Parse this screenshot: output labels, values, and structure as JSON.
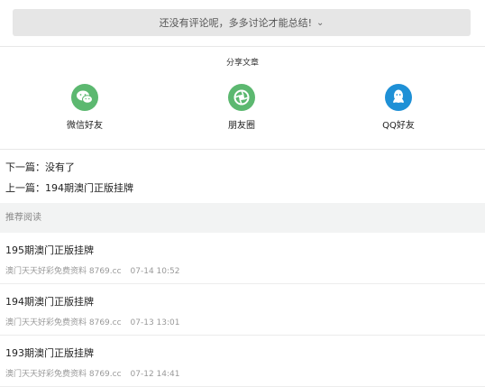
{
  "comment": {
    "text": "还没有评论呢，多多讨论才能总结!",
    "chevron": "⌄"
  },
  "share": {
    "title": "分享文章",
    "items": [
      {
        "label": "微信好友",
        "icon": "wechat-icon",
        "color": "#5cb870"
      },
      {
        "label": "朋友圈",
        "icon": "moments-icon",
        "color": "#5cb870"
      },
      {
        "label": "QQ好友",
        "icon": "qq-icon",
        "color": "#1e90d6"
      }
    ]
  },
  "nav": {
    "next_prefix": "下一篇：",
    "next_title": "没有了",
    "prev_prefix": "上一篇：",
    "prev_title": "194期澳门正版挂牌"
  },
  "recommend": {
    "header": "推荐阅读",
    "items": [
      {
        "title": "195期澳门正版挂牌",
        "source": "澳门天天好彩免费资料 8769.cc",
        "date": "07-14 10:52"
      },
      {
        "title": "194期澳门正版挂牌",
        "source": "澳门天天好彩免费资料 8769.cc",
        "date": "07-13 13:01"
      },
      {
        "title": "193期澳门正版挂牌",
        "source": "澳门天天好彩免费资料 8769.cc",
        "date": "07-12 14:41"
      }
    ]
  }
}
